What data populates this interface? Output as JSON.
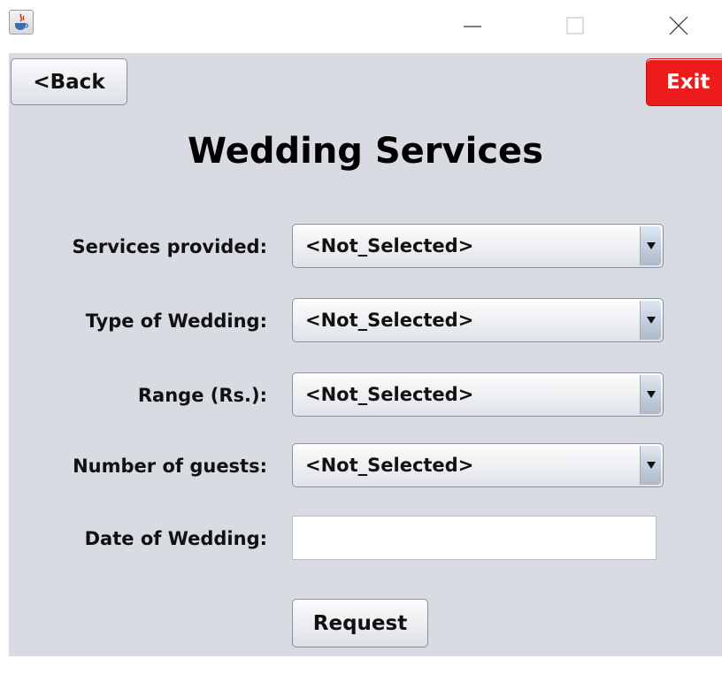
{
  "window": {
    "title": "",
    "icons": [
      "java-icon",
      "minimize-icon",
      "maximize-icon",
      "close-icon"
    ]
  },
  "toolbar": {
    "back_label": "<Back",
    "exit_label": "Exit"
  },
  "page": {
    "title": "Wedding Services"
  },
  "form": {
    "fields": [
      {
        "label": "Services provided:",
        "value": "<Not_Selected>"
      },
      {
        "label": "Type of Wedding:",
        "value": "<Not_Selected>"
      },
      {
        "label": "Range (Rs.):",
        "value": "<Not_Selected>"
      },
      {
        "label": "Number of guests:",
        "value": "<Not_Selected>"
      }
    ],
    "date_label": "Date of Wedding:",
    "date_value": "",
    "submit_label": "Request"
  },
  "colors": {
    "panel_background": "#d8dbe1",
    "exit_background": "#ec1c1c",
    "exit_text": "#ffffff"
  }
}
